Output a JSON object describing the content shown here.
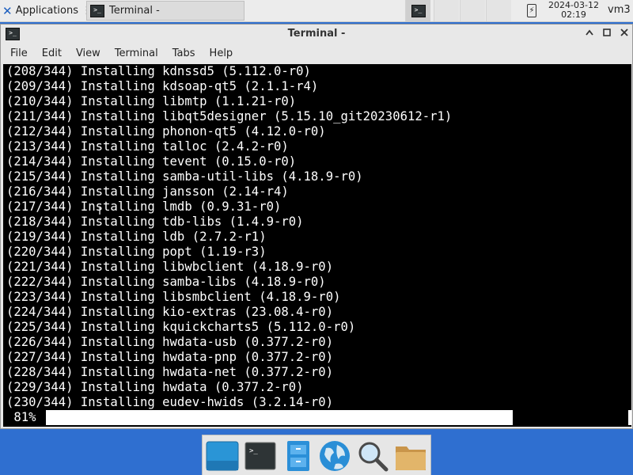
{
  "top_panel": {
    "applications_label": "Applications",
    "task_title": "Terminal -",
    "date": "2024-03-12",
    "time": "02:19",
    "user": "vm3"
  },
  "window": {
    "title": "Terminal -",
    "menu": [
      "File",
      "Edit",
      "View",
      "Terminal",
      "Tabs",
      "Help"
    ]
  },
  "terminal": {
    "lines": [
      "(208/344) Installing kdnssd5 (5.112.0-r0)",
      "(209/344) Installing kdsoap-qt5 (2.1.1-r4)",
      "(210/344) Installing libmtp (1.1.21-r0)",
      "(211/344) Installing libqt5designer (5.15.10_git20230612-r1)",
      "(212/344) Installing phonon-qt5 (4.12.0-r0)",
      "(213/344) Installing talloc (2.4.2-r0)",
      "(214/344) Installing tevent (0.15.0-r0)",
      "(215/344) Installing samba-util-libs (4.18.9-r0)",
      "(216/344) Installing jansson (2.14-r4)",
      "(217/344) Installing lmdb (0.9.31-r0)",
      "(218/344) Installing tdb-libs (1.4.9-r0)",
      "(219/344) Installing ldb (2.7.2-r1)",
      "(220/344) Installing popt (1.19-r3)",
      "(221/344) Installing libwbclient (4.18.9-r0)",
      "(222/344) Installing samba-libs (4.18.9-r0)",
      "(223/344) Installing libsmbclient (4.18.9-r0)",
      "(224/344) Installing kio-extras (23.08.4-r0)",
      "(225/344) Installing kquickcharts5 (5.112.0-r0)",
      "(226/344) Installing hwdata-usb (0.377.2-r0)",
      "(227/344) Installing hwdata-pnp (0.377.2-r0)",
      "(228/344) Installing hwdata-net (0.377.2-r0)",
      "(229/344) Installing hwdata (0.377.2-r0)",
      "(230/344) Installing eudev-hwids (3.2.14-r0)"
    ],
    "progress_text": " 81%",
    "progress_fraction": 0.81,
    "colors": {
      "background": "#000000",
      "foreground": "#ffffff"
    }
  },
  "dock": {
    "items": [
      "show-desktop-icon",
      "terminal-icon",
      "file-manager-icon",
      "web-browser-icon",
      "app-finder-icon",
      "home-folder-icon"
    ]
  }
}
